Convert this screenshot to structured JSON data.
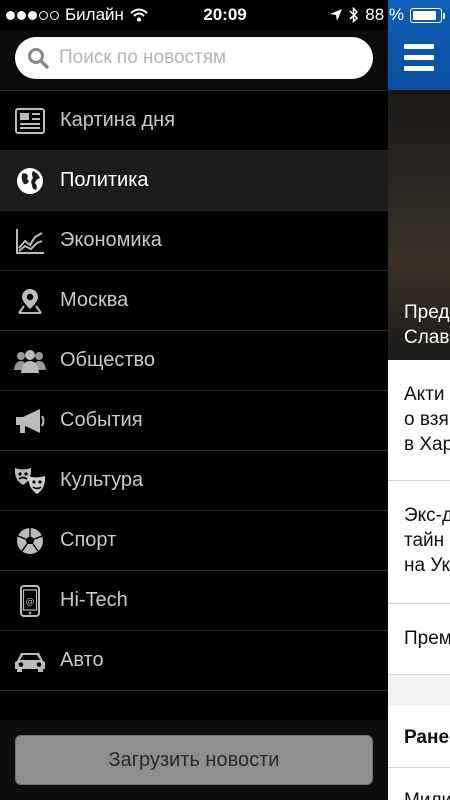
{
  "status_bar": {
    "carrier": "Билайн",
    "time": "20:09",
    "battery": "88 %",
    "signal_bars_filled": 3,
    "signal_bars_total": 5,
    "battery_level": 0.88
  },
  "search": {
    "placeholder": "Поиск по новостям",
    "value": ""
  },
  "menu": {
    "items": [
      {
        "label": "Картина дня",
        "icon": "newspaper-icon"
      },
      {
        "label": "Политика",
        "icon": "globe-icon",
        "active": true
      },
      {
        "label": "Экономика",
        "icon": "chart-line-icon"
      },
      {
        "label": "Москва",
        "icon": "map-pin-icon"
      },
      {
        "label": "Общество",
        "icon": "people-icon"
      },
      {
        "label": "События",
        "icon": "megaphone-icon"
      },
      {
        "label": "Культура",
        "icon": "theater-masks-icon"
      },
      {
        "label": "Спорт",
        "icon": "soccer-ball-icon"
      },
      {
        "label": "Hi-Tech",
        "icon": "phone-icon"
      },
      {
        "label": "Авто",
        "icon": "car-icon"
      }
    ]
  },
  "load_button": {
    "label": "Загрузить новости"
  },
  "content": {
    "hero_title": "Пред\nСлав",
    "articles": [
      {
        "title": "Акти\nо взя\nв Хар"
      },
      {
        "title": "Экс-д\nтайн\nна Ук"
      },
      {
        "title": "Прем"
      }
    ],
    "section_label": "Ранее",
    "last_article": "Мили"
  }
}
